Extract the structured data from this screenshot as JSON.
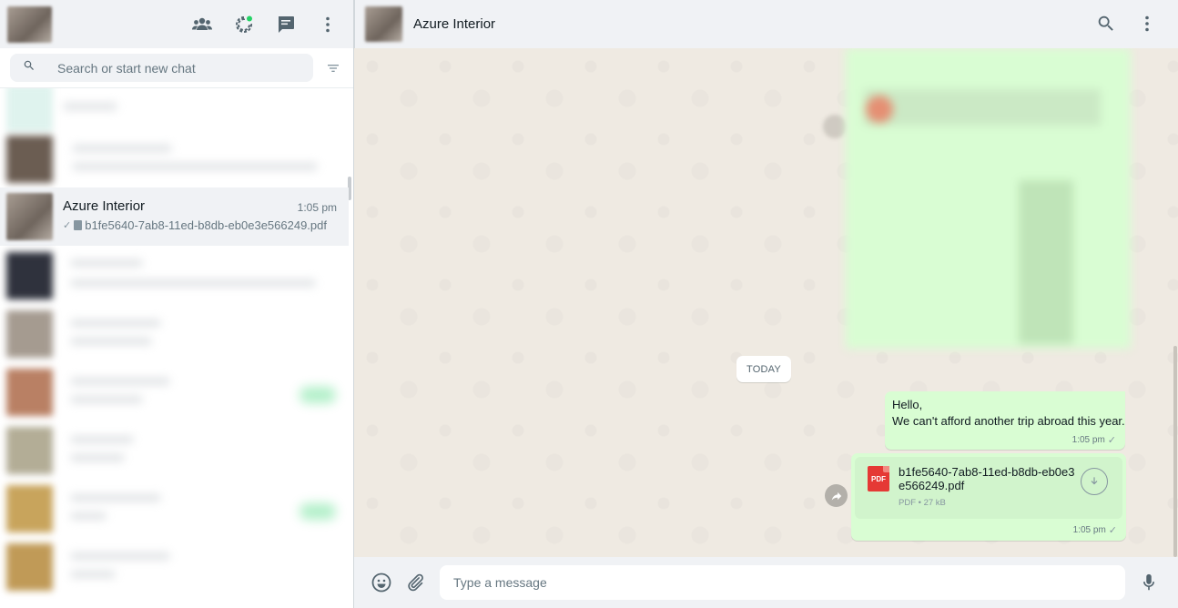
{
  "sidebar": {
    "search_placeholder": "Search or start new chat",
    "active_chat": {
      "name": "Azure Interior",
      "time": "1:05 pm",
      "tick": "✓",
      "last_message": "b1fe5640-7ab8-11ed-b8db-eb0e3e566249.pdf"
    }
  },
  "conversation": {
    "title": "Azure Interior",
    "day_chip": "TODAY",
    "message1": {
      "line1": "Hello,",
      "line2": "We can't afford another trip abroad this year.",
      "time": "1:05 pm",
      "tick": "✓"
    },
    "message2": {
      "badge": "PDF",
      "file_name": "b1fe5640-7ab8-11ed-b8db-eb0e3e566249.pdf",
      "file_info": "PDF • 27 kB",
      "time": "1:05 pm",
      "tick": "✓"
    },
    "composer_placeholder": "Type a message"
  },
  "colors": {
    "outgoing_bubble": "#d9fdd3",
    "pdf_icon": "#e53935",
    "panel_bg": "#f0f2f5",
    "chat_bg": "#efeae2"
  },
  "icons": [
    "communities-icon",
    "status-icon",
    "new-chat-icon",
    "menu-icon",
    "search-icon",
    "filter-icon",
    "emoji-icon",
    "attach-icon",
    "mic-icon",
    "download-icon",
    "forward-icon"
  ]
}
